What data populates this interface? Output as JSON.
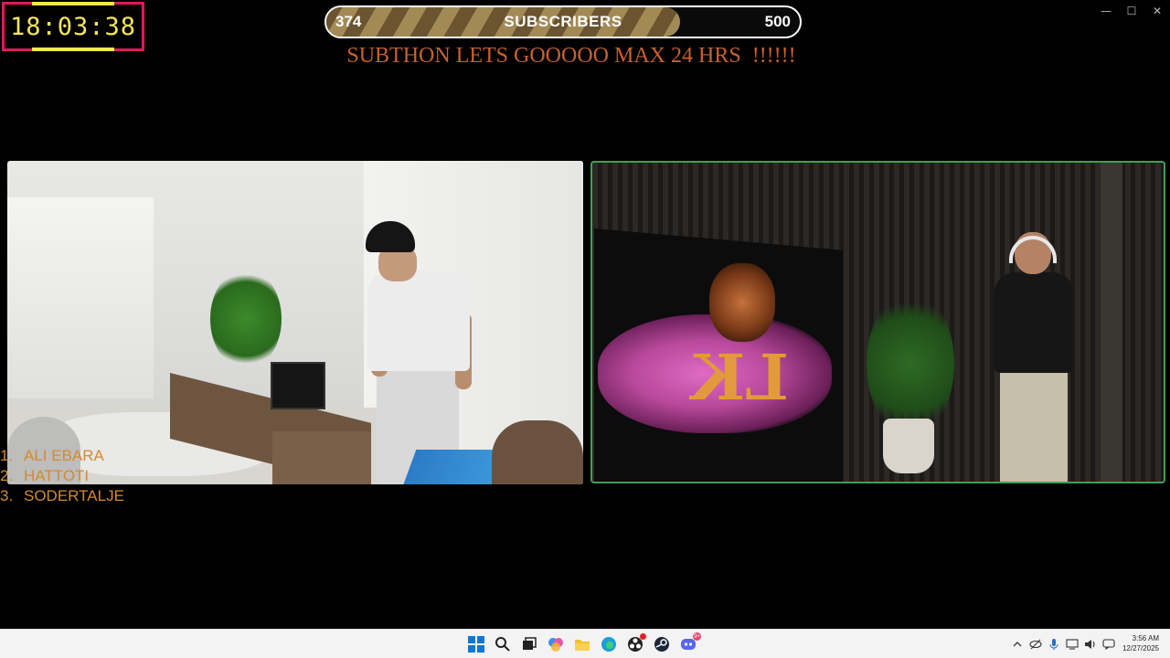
{
  "window": {
    "controls": {
      "minimize": "—",
      "maximize": "☐",
      "close": "✕"
    }
  },
  "overlay": {
    "timer": "18:03:38",
    "subscriber_goal": {
      "current": "374",
      "label": "SUBSCRIBERS",
      "goal": "500",
      "progress_fraction": 0.748
    },
    "banner": "SUBTHON LETS GOOOOO MAX 24 HRS  !!!!!!",
    "leaderboard": [
      {
        "rank": "1.",
        "name": "ALI EBARA"
      },
      {
        "rank": "2.",
        "name": "HATTOTI"
      },
      {
        "rank": "3.",
        "name": "SODERTALJE"
      }
    ],
    "stream_logo_text": "LK",
    "colors": {
      "timer_border": "#e0195a",
      "timer_text": "#f5e65a",
      "banner": "#c8612d",
      "leaderboard": "#d28a32",
      "cam_border_right": "#3fa052"
    }
  },
  "taskbar": {
    "apps": [
      {
        "name": "start",
        "icon": "windows-logo-icon"
      },
      {
        "name": "search",
        "icon": "search-icon"
      },
      {
        "name": "task-view",
        "icon": "task-view-icon"
      },
      {
        "name": "copilot",
        "icon": "copilot-icon"
      },
      {
        "name": "file-explorer",
        "icon": "folder-icon"
      },
      {
        "name": "edge",
        "icon": "edge-icon"
      },
      {
        "name": "obs",
        "icon": "obs-icon"
      },
      {
        "name": "steam",
        "icon": "steam-icon"
      },
      {
        "name": "discord",
        "icon": "discord-icon",
        "badge": "9+"
      }
    ],
    "tray": [
      "chevron-up-icon",
      "hidden-eye-icon",
      "microphone-icon",
      "network-icon",
      "speaker-icon",
      "chat-icon"
    ],
    "clock": {
      "time": "3:56 AM",
      "date": "12/27/2025"
    }
  }
}
